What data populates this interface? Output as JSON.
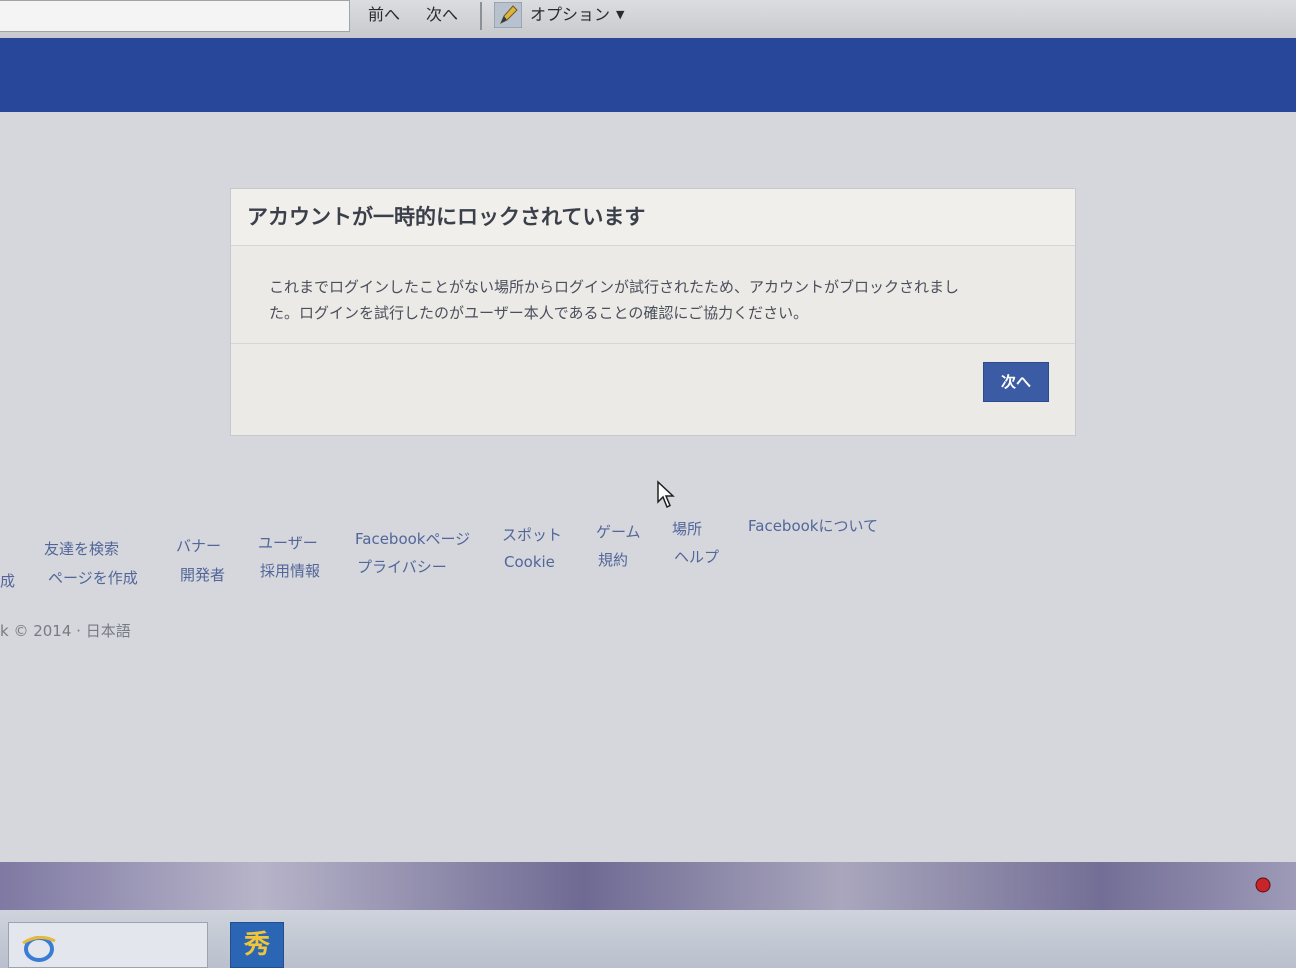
{
  "browser_toolbar": {
    "find_value": "",
    "prev_label": "前へ",
    "next_label": "次へ",
    "options_label": "オプション"
  },
  "colors": {
    "facebook_blue": "#29479a",
    "button_blue": "#3b5ba5",
    "link_blue": "#52669a"
  },
  "dialog": {
    "title": "アカウントが一時的にロックされています",
    "body_line1": "これまでログインしたことがない場所からログインが試行されたため、アカウントがブロックされまし",
    "body_line2": "た。ログインを試行したのがユーザー本人であることの確認にご協力ください。",
    "next_button": "次へ"
  },
  "footer": {
    "row1": {
      "find_friends": "友達を検索",
      "badges": "バナー",
      "people": "ユーザー",
      "pages": "Facebookページ",
      "spots": "スポット",
      "games": "ゲーム",
      "places": "場所",
      "about": "Facebookについて"
    },
    "row2": {
      "create_fragment": "成",
      "create_page": "ページを作成",
      "developers": "開発者",
      "careers": "採用情報",
      "privacy": "プライバシー",
      "cookie": "Cookie",
      "terms": "規約",
      "help": "ヘルプ"
    },
    "copyright": "k © 2014 · 日本語"
  },
  "taskbar": {
    "app2_glyph": "秀"
  },
  "icons": [
    "pen-icon",
    "chevron-down-icon",
    "cursor-icon",
    "ie-icon",
    "tray-icon"
  ]
}
